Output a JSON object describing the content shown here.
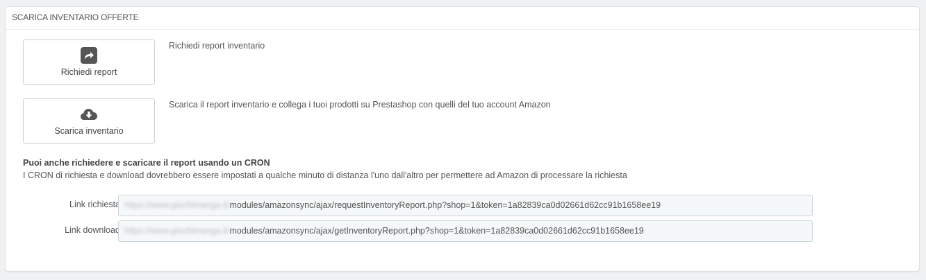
{
  "panel": {
    "title": "SCARICA INVENTARIO OFFERTE"
  },
  "actions": [
    {
      "button_label": "Richiedi report",
      "icon": "share-arrow-icon",
      "description": "Richiedi report inventario"
    },
    {
      "button_label": "Scarica inventario",
      "icon": "cloud-download-icon",
      "description": "Scarica il report inventario e collega i tuoi prodotti su Prestashop con quelli del tuo account Amazon"
    }
  ],
  "cron": {
    "title": "Puoi anche richiedere e scaricare il report usando un CRON",
    "description": "I CRON di richiesta e download dovrebbero essere impostati a qualche minuto di distanza l'uno dall'altro per permettere ad Amazon di processare la richiesta"
  },
  "links": {
    "request": {
      "label": "Link richiesta",
      "blurred_prefix": "https://www.giochimanga.it/",
      "path": "modules/amazonsync/ajax/requestInventoryReport.php?shop=1&token=1a82839ca0d02661d62cc91b1658ee19"
    },
    "download": {
      "label": "Link download",
      "blurred_prefix": "https://www.giochimanga.it/",
      "path": "modules/amazonsync/ajax/getInventoryReport.php?shop=1&token=1a82839ca0d02661d62cc91b1658ee19"
    }
  },
  "colors": {
    "icon": "#555555",
    "panel_border": "#dcdfe3",
    "background": "#eff1f2"
  }
}
